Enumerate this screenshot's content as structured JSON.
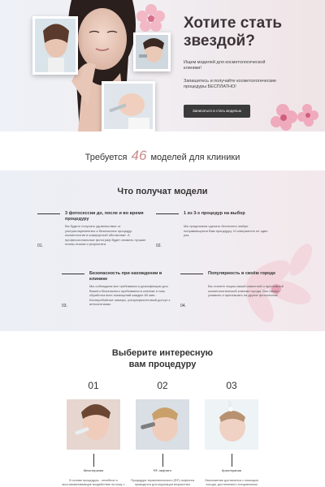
{
  "hero": {
    "title": "Хотите стать звездой?",
    "sub1": "Ищем моделей для косметологической клиники!",
    "sub2": "Запишитесь и получайте косметологические процедуры БЕСПЛАТНО!",
    "cta": "Записаться и стать моделью"
  },
  "count": {
    "prefix": "Требуется",
    "number": "46",
    "suffix": "моделей для клиники"
  },
  "benefits": {
    "title": "Что получат модели",
    "items": [
      {
        "num": "01.",
        "title": "3 фотосессии до, после и во время процедуру",
        "desc": "Вы будете получать удовольствие от ультрасовременных и безопасных процедур косметологии в комфортной обстановке. А профессиональные фотограф будет снимать лучшие планы этапов и результата."
      },
      {
        "num": "02.",
        "title": "1 из 3-х процедур на выбор",
        "desc": "Мы предлагаем сделать бесплатно любую понравившуюся Вам процедуру. И совершенно не один раз."
      },
      {
        "num": "03.",
        "title": "Безопасность при нахождении в клинике",
        "desc": "Мы соблюдаем все требования и дезинфекцию для Вашего безопасного пребывания в клинике и наш обработка всех помещений каждые 60 мин.. Бесперебойные замеры, ультрафиолетовый доступ к антисептикам."
      },
      {
        "num": "04.",
        "title": "Популярность в своём городе",
        "desc": "Вы станете лицом самой известной и престижной косметологической клиники города. Вас начнут узнавать и приглашать на другие фотосессии!"
      }
    ]
  },
  "procedures": {
    "title_line1": "Выберите интересную",
    "title_line2": "вам процедуру",
    "items": [
      {
        "num": "01",
        "name": "Мезотерапия",
        "desc": "В основе процедуры - лечебное и восстанавливающие воздействие на кожу с помощью инъекций из гиалуроновой кислоты, витаминов, микроэлементов."
      },
      {
        "num": "02",
        "name": "RF-лифтинг",
        "desc": "Процедура терапевтического (RF) лифтинга проводится для коррекции возрастных изменений кожи без операции. Моментальный подтяжка."
      },
      {
        "num": "03",
        "name": "Криотерапия",
        "desc": "Омоложение достигается с помощью холода, достигаемого специальным аппаратом при температуре до -70 °С и отвод."
      }
    ]
  },
  "colors": {
    "accent": "#c98a8a",
    "button": "#3b3b3b"
  },
  "icons": [
    "cherry-blossom-icon"
  ]
}
